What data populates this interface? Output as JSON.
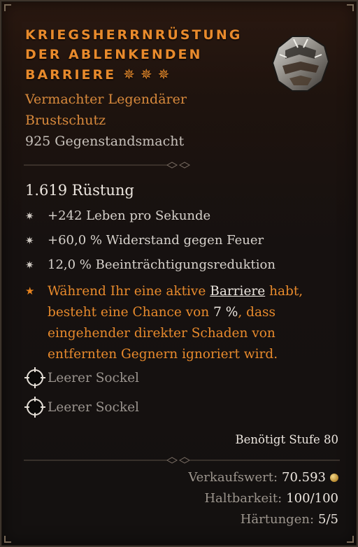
{
  "item": {
    "name_lines": [
      "KRIEGSHERRNRÜSTUNG",
      "DER ABLENKENDEN",
      "BARRIERE"
    ],
    "stars": "✵✵✵",
    "rarity_line1": "Vermachter Legendärer",
    "rarity_line2": "Brustschutz",
    "item_power": "925 Gegenstandsmacht",
    "armor": "1.619 Rüstung",
    "affixes": [
      "+242 Leben pro Sekunde",
      "+60,0 % Widerstand gegen Feuer",
      "12,0 % Beeinträchtigungsreduktion"
    ],
    "legendary_aspect": {
      "line1_pre": "Während Ihr eine aktive ",
      "line1_highlight": "Barriere",
      "line1_post": " habt,",
      "line2_pre": "besteht eine Chance von ",
      "line2_highlight": "7 %",
      "line2_post": ", dass",
      "line3": "eingehender direkter Schaden von",
      "line4": "entfernten Gegnern ignoriert wird."
    },
    "sockets": [
      "Leerer Sockel",
      "Leerer Sockel"
    ],
    "required_level": "Benötigt Stufe 80",
    "sell_value_label": "Verkaufswert:",
    "sell_value": "70.593",
    "durability_label": "Haltbarkeit:",
    "durability": "100/100",
    "tempers_label": "Härtungen:",
    "tempers": "5/5"
  },
  "colors": {
    "legendary_orange": "#e88a2c",
    "stat_white": "#ece6df",
    "muted_gray": "#9a948e",
    "border": "#3d342c"
  },
  "icons": {
    "affix_bullet": "snowflake-bullet-icon",
    "legendary_bullet": "star-bullet-icon",
    "socket": "empty-socket-icon",
    "currency": "gold-coin-icon",
    "item": "chest-armor-icon"
  }
}
